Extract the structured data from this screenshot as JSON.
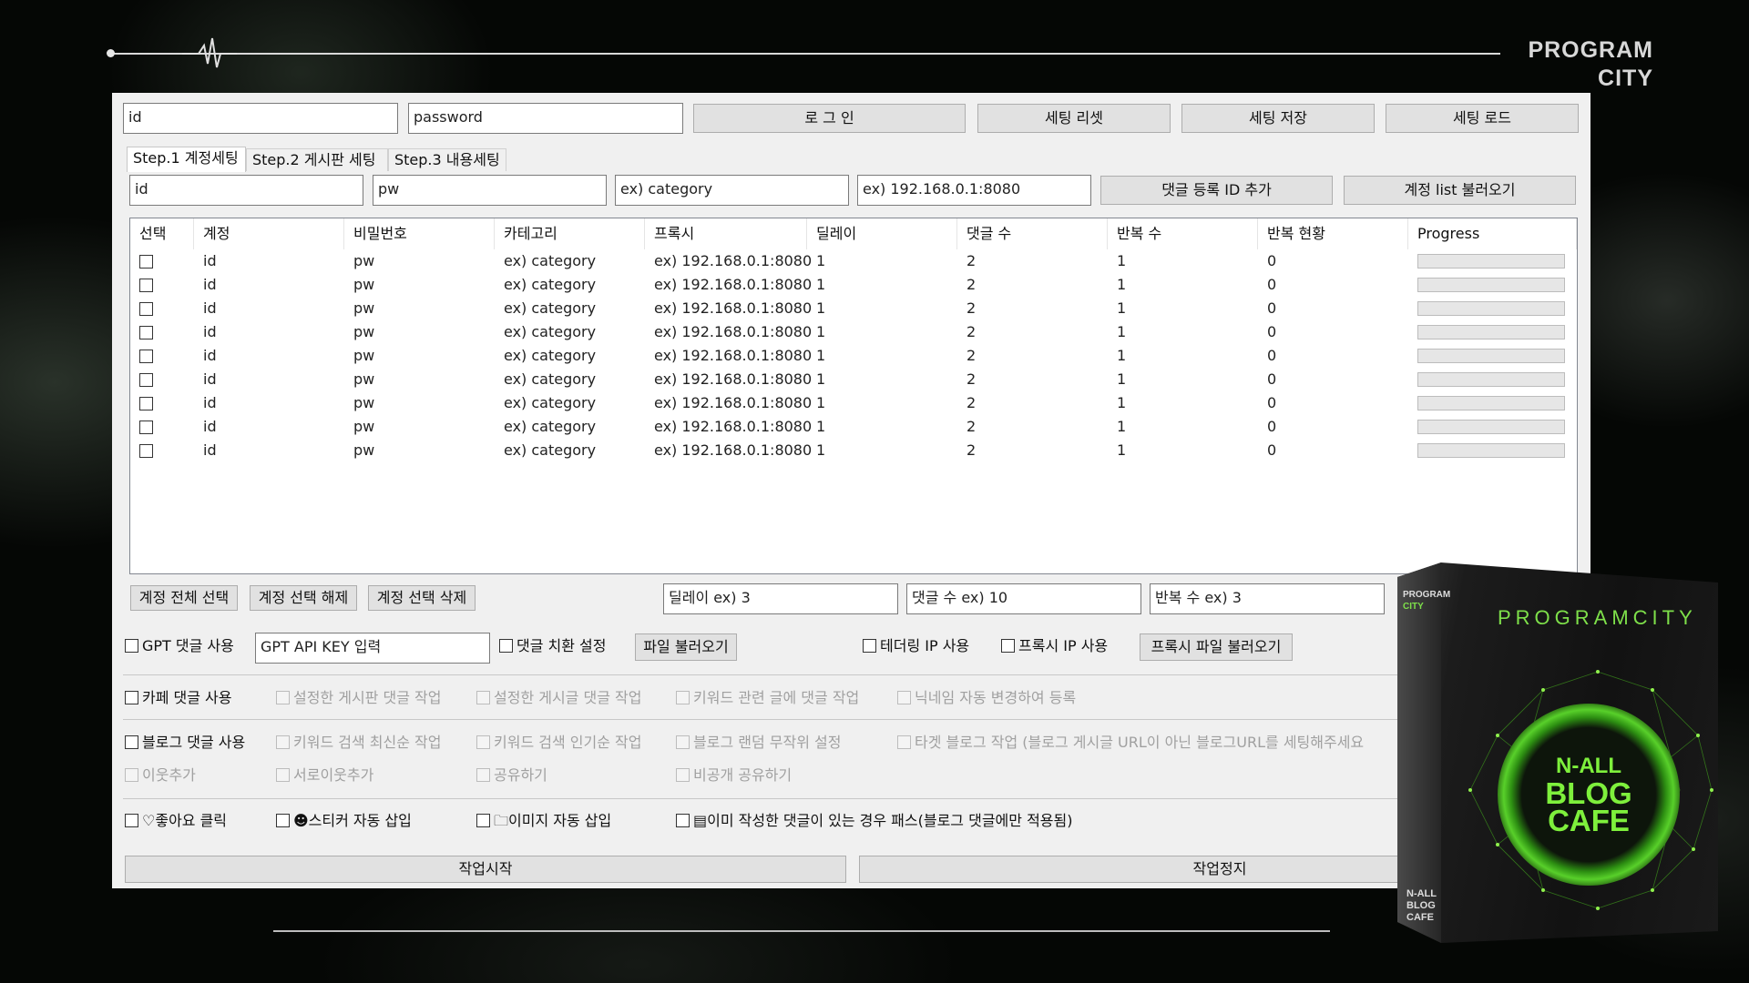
{
  "brand": {
    "line1": "PROGRAM",
    "line2": "CITY"
  },
  "login": {
    "id": "id",
    "password": "password",
    "login_btn": "로 그 인",
    "reset_btn": "세팅 리셋",
    "save_btn": "세팅 저장",
    "load_btn": "세팅 로드"
  },
  "tabs": [
    "Step.1 계정세팅",
    "Step.2 게시판 세팅",
    "Step.3 내용세팅"
  ],
  "account_inputs": {
    "id": "id",
    "pw": "pw",
    "category": "ex) category",
    "proxy": "ex) 192.168.0.1:8080",
    "add_btn": "댓글 등록 ID 추가",
    "load_list_btn": "계정 list 불러오기"
  },
  "table": {
    "headers": [
      "선택",
      "계정",
      "비밀번호",
      "카테고리",
      "프록시",
      "딜레이",
      "댓글 수",
      "반복 수",
      "반복 현황",
      "Progress"
    ],
    "rows": [
      {
        "account": "id",
        "pw": "pw",
        "category": "ex) category",
        "proxy": "ex) 192.168.0.1:8080",
        "delay": "1",
        "comments": "2",
        "repeat": "1",
        "status": "0",
        "progress": 0
      },
      {
        "account": "id",
        "pw": "pw",
        "category": "ex) category",
        "proxy": "ex) 192.168.0.1:8080",
        "delay": "1",
        "comments": "2",
        "repeat": "1",
        "status": "0",
        "progress": 0
      },
      {
        "account": "id",
        "pw": "pw",
        "category": "ex) category",
        "proxy": "ex) 192.168.0.1:8080",
        "delay": "1",
        "comments": "2",
        "repeat": "1",
        "status": "0",
        "progress": 0
      },
      {
        "account": "id",
        "pw": "pw",
        "category": "ex) category",
        "proxy": "ex) 192.168.0.1:8080",
        "delay": "1",
        "comments": "2",
        "repeat": "1",
        "status": "0",
        "progress": 0
      },
      {
        "account": "id",
        "pw": "pw",
        "category": "ex) category",
        "proxy": "ex) 192.168.0.1:8080",
        "delay": "1",
        "comments": "2",
        "repeat": "1",
        "status": "0",
        "progress": 0
      },
      {
        "account": "id",
        "pw": "pw",
        "category": "ex) category",
        "proxy": "ex) 192.168.0.1:8080",
        "delay": "1",
        "comments": "2",
        "repeat": "1",
        "status": "0",
        "progress": 0
      },
      {
        "account": "id",
        "pw": "pw",
        "category": "ex) category",
        "proxy": "ex) 192.168.0.1:8080",
        "delay": "1",
        "comments": "2",
        "repeat": "1",
        "status": "0",
        "progress": 0
      },
      {
        "account": "id",
        "pw": "pw",
        "category": "ex) category",
        "proxy": "ex) 192.168.0.1:8080",
        "delay": "1",
        "comments": "2",
        "repeat": "1",
        "status": "0",
        "progress": 0
      },
      {
        "account": "id",
        "pw": "pw",
        "category": "ex) category",
        "proxy": "ex) 192.168.0.1:8080",
        "delay": "1",
        "comments": "2",
        "repeat": "1",
        "status": "0",
        "progress": 0
      }
    ]
  },
  "grid_actions": {
    "select_all": "계정 전체 선택",
    "deselect": "계정 선택 해제",
    "delete": "계정 선택 삭제",
    "delay": "딜레이 ex) 3",
    "comment_count": "댓글 수 ex) 10",
    "repeat_count": "반복 수 ex) 3"
  },
  "options": {
    "gpt": "GPT 댓글 사용",
    "gpt_key": "GPT API KEY 입력",
    "replace": "댓글 치환 설정",
    "file_load": "파일 불러오기",
    "tethering": "테더링 IP 사용",
    "proxy_ip": "프록시 IP 사용",
    "proxy_file": "프록시 파일 불러오기",
    "cafe": "카페 댓글 사용",
    "cafe_board": "설정한 게시판 댓글 작업",
    "cafe_post": "설정한 게시글 댓글 작업",
    "cafe_keyword": "키워드 관련 글에 댓글 작업",
    "cafe_nick": "닉네임 자동 변경하여 등록",
    "blog": "블로그 댓글 사용",
    "blog_latest": "키워드 검색 최신순 작업",
    "blog_popular": "키워드 검색 인기순 작업",
    "blog_random": "블로그 랜덤 무작위 설정",
    "blog_target": "타겟 블로그 작업 (블로그 게시글 URL이 아닌 블로그URL를 세팅해주세요",
    "neighbor": "이웃추가",
    "mutual": "서로이웃추가",
    "share": "공유하기",
    "private_share": "비공개 공유하기",
    "like": "♡좋아요 클릭",
    "sticker": "☻스티커 자동 삽입",
    "image": "🗀이미지 자동 삽입",
    "skip": "▤이미 작성한 댓글이 있는 경우 패스(블로그 댓글에만 적용됨)",
    "start": "작업시작",
    "stop": "작업정지"
  },
  "box": {
    "title": "PROGRAMCITY",
    "spine_top1": "PROGRAM",
    "spine_top2": "CITY",
    "logo1": "N-ALL",
    "logo2": "BLOG",
    "logo3": "CAFE",
    "spine_bottom1": "N-ALL",
    "spine_bottom2": "BLOG",
    "spine_bottom3": "CAFE"
  },
  "colors": {
    "accent_green": "#7ee04a",
    "background": "#050705"
  }
}
